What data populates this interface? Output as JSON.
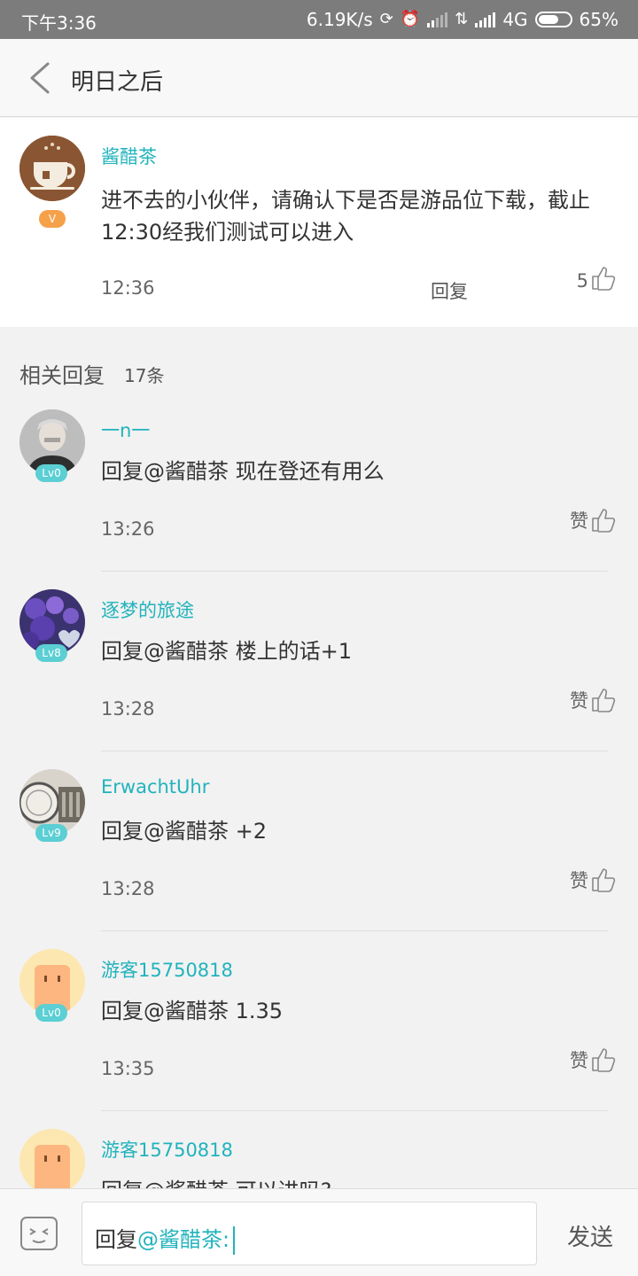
{
  "status_bar": {
    "time": "下午3:36",
    "speed": "6.19K/s",
    "network": "4G",
    "battery": "65%",
    "battery_level": 0.65
  },
  "header": {
    "title": "明日之后"
  },
  "main_comment": {
    "username": "酱醋茶",
    "badge": "V",
    "text": "进不去的小伙伴，请确认下是否是游品位下载，截止12:30经我们测试可以进入",
    "time": "12:36",
    "reply_label": "回复",
    "likes": "5"
  },
  "replies_section": {
    "title": "相关回复",
    "count": "17条"
  },
  "replies": [
    {
      "username": "一n一",
      "level": "Lv0",
      "prefix": "回复@酱醋茶",
      "text": "现在登还有用么",
      "time": "13:26",
      "like_label": "赞"
    },
    {
      "username": "逐梦的旅途",
      "level": "Lv8",
      "prefix": "回复@酱醋茶",
      "text": "楼上的话+1",
      "time": "13:28",
      "like_label": "赞"
    },
    {
      "username": "ErwachtUhr",
      "level": "Lv9",
      "prefix": "回复@酱醋茶",
      "text": "+2",
      "time": "13:28",
      "like_label": "赞"
    },
    {
      "username": "游客15750818",
      "level": "Lv0",
      "prefix": "回复@酱醋茶",
      "text": "1.35",
      "time": "13:35",
      "like_label": "赞"
    },
    {
      "username": "游客15750818",
      "level": "Lv0",
      "prefix": "回复@酱醋茶",
      "text": "可以进吗?",
      "time": "",
      "like_label": ""
    }
  ],
  "input": {
    "prefix": "回复",
    "mention": "@酱醋茶:",
    "send_label": "发送"
  },
  "colors": {
    "accent": "#21b3bc",
    "status_bar": "#7c7c7c",
    "level_badge": "#5bcfd3",
    "v_badge": "#f5a14a"
  }
}
